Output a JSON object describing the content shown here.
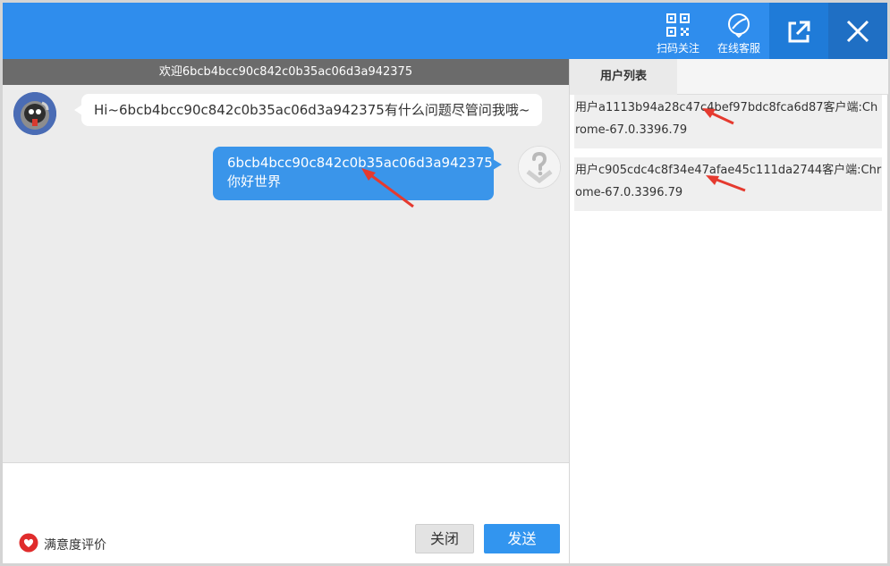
{
  "header": {
    "qr_label": "扫码关注",
    "cs_label": "在线客服"
  },
  "chat": {
    "welcome": "欢迎6bcb4bcc90c842c0b35ac06d3a942375",
    "messages": [
      {
        "side": "left",
        "text": "Hi~6bcb4bcc90c842c0b35ac06d3a942375有什么问题尽管问我哦~"
      },
      {
        "side": "right",
        "line1": "6bcb4bcc90c842c0b35ac06d3a942375",
        "line2": "你好世界"
      }
    ]
  },
  "footer": {
    "satisfaction_label": "满意度评价",
    "close_label": "关闭",
    "send_label": "发送"
  },
  "user_list": {
    "tab_label": "用户列表",
    "users": [
      {
        "text": "用户a1113b94a28c47c4bef97bdc8fca6d87客户端:Chrome-67.0.3396.79"
      },
      {
        "text": "用户c905cdc4c8f34e47afae45c111da2744客户端:Chrome-67.0.3396.79"
      }
    ]
  },
  "colors": {
    "header_blue": "#2f8ded",
    "bubble_blue": "#3a95ea",
    "send_blue": "#3295ef",
    "annotation_red": "#e53a2f"
  }
}
